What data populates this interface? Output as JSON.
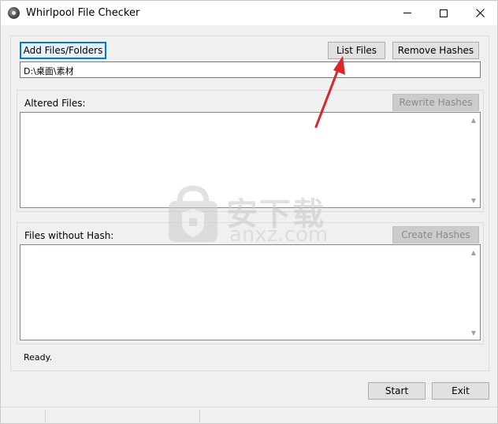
{
  "window": {
    "title": "Whirlpool File Checker",
    "minimize_label": "minimize",
    "maximize_label": "maximize",
    "close_label": "close"
  },
  "toolbar": {
    "add_files_label": "Add Files/Folders",
    "list_files_label": "List Files",
    "remove_hashes_label": "Remove Hashes"
  },
  "path": {
    "value": "D:\\桌面\\素材"
  },
  "altered": {
    "label": "Altered Files:",
    "rewrite_label": "Rewrite Hashes",
    "rewrite_enabled": false
  },
  "without_hash": {
    "label": "Files without Hash:",
    "create_label": "Create Hashes",
    "create_enabled": false
  },
  "status": {
    "text": "Ready."
  },
  "footer": {
    "start_label": "Start",
    "exit_label": "Exit"
  },
  "watermark": {
    "cn": "安下载",
    "en": "anxz.com"
  },
  "colors": {
    "focus_border": "#0078d7",
    "annotation_arrow": "#d9262b"
  }
}
